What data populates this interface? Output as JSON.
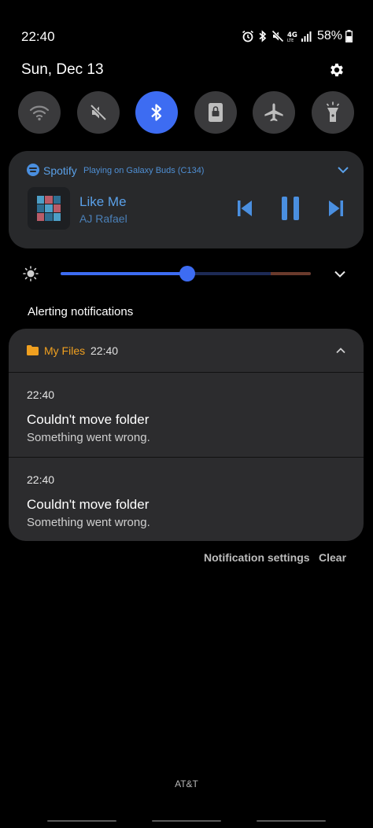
{
  "status_bar": {
    "time": "22:40",
    "battery": "58%",
    "icons": [
      "alarm-icon",
      "bluetooth-icon",
      "mute-icon",
      "4g-lte-icon",
      "signal-icon",
      "battery-icon"
    ]
  },
  "header": {
    "date": "Sun, Dec 13",
    "settings_icon": "gear-icon"
  },
  "quick_toggles": [
    {
      "name": "wifi",
      "icon": "wifi-icon",
      "on": false
    },
    {
      "name": "sound",
      "icon": "mute-icon",
      "on": false
    },
    {
      "name": "bluetooth",
      "icon": "bluetooth-icon",
      "on": true
    },
    {
      "name": "rotation-lock",
      "icon": "lock-icon",
      "on": false
    },
    {
      "name": "airplane",
      "icon": "airplane-icon",
      "on": false
    },
    {
      "name": "flashlight",
      "icon": "flashlight-icon",
      "on": false
    }
  ],
  "media": {
    "app": "Spotify",
    "device": "Playing on Galaxy Buds (C134)",
    "title": "Like Me",
    "artist": "AJ Rafael"
  },
  "brightness": {
    "level": 0.505
  },
  "section_title": "Alerting notifications",
  "notification_group": {
    "app": "My Files",
    "time": "22:40",
    "items": [
      {
        "time": "22:40",
        "title": "Couldn't move folder",
        "body": "Something went wrong."
      },
      {
        "time": "22:40",
        "title": "Couldn't move folder",
        "body": "Something went wrong."
      }
    ]
  },
  "actions": {
    "settings": "Notification settings",
    "clear": "Clear"
  },
  "carrier": "AT&T",
  "colors": {
    "accent": "#3d6cf2",
    "toggle_off": "#3a3a3c",
    "media_text": "#5aa0e8",
    "files_app": "#f0a020",
    "card": "#2c2c2e"
  }
}
